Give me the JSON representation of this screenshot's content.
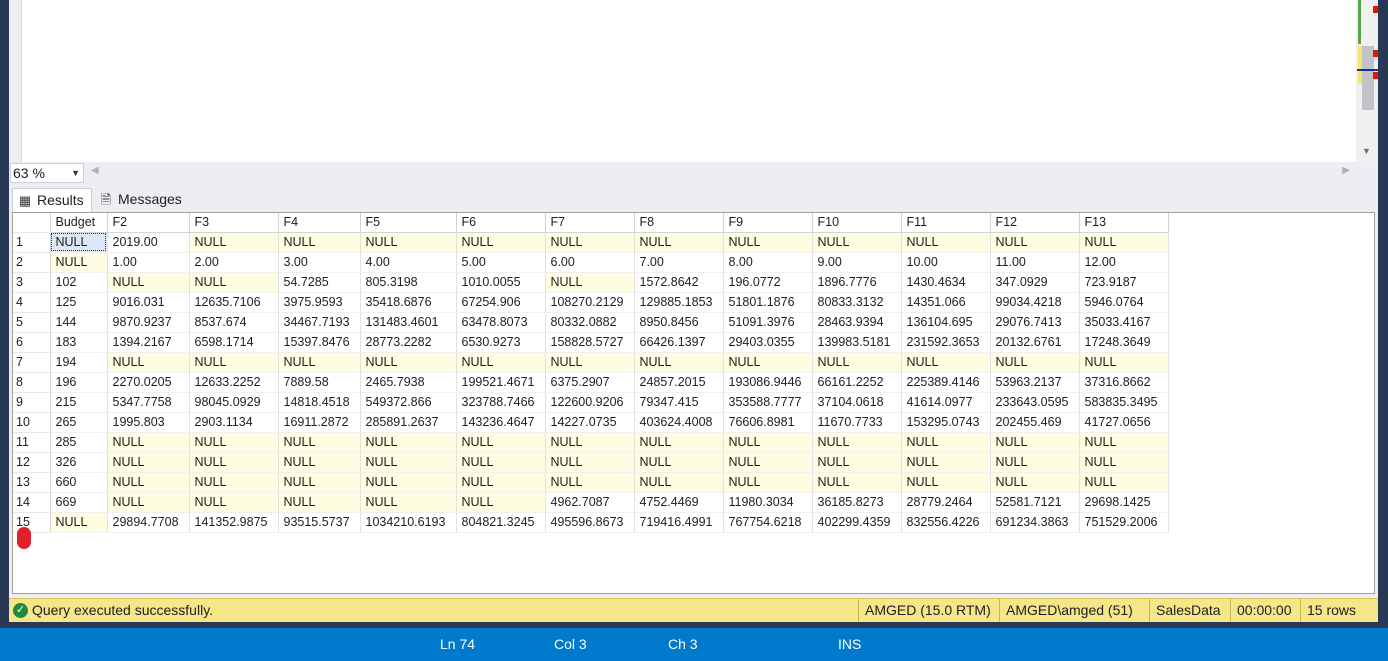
{
  "zoom": {
    "value": "63 %"
  },
  "tabs": {
    "results": "Results",
    "messages": "Messages"
  },
  "grid": {
    "columns": [
      "Budget",
      "F2",
      "F3",
      "F4",
      "F5",
      "F6",
      "F7",
      "F8",
      "F9",
      "F10",
      "F11",
      "F12",
      "F13"
    ],
    "rows": [
      [
        "1",
        "NULL",
        "2019.00",
        "NULL",
        "NULL",
        "NULL",
        "NULL",
        "NULL",
        "NULL",
        "NULL",
        "NULL",
        "NULL",
        "NULL",
        "NULL"
      ],
      [
        "2",
        "NULL",
        "1.00",
        "2.00",
        "3.00",
        "4.00",
        "5.00",
        "6.00",
        "7.00",
        "8.00",
        "9.00",
        "10.00",
        "11.00",
        "12.00"
      ],
      [
        "3",
        "102",
        "NULL",
        "NULL",
        "54.7285",
        "805.3198",
        "1010.0055",
        "NULL",
        "1572.8642",
        "196.0772",
        "1896.7776",
        "1430.4634",
        "347.0929",
        "723.9187"
      ],
      [
        "4",
        "125",
        "9016.031",
        "12635.7106",
        "3975.9593",
        "35418.6876",
        "67254.906",
        "108270.2129",
        "129885.1853",
        "51801.1876",
        "80833.3132",
        "14351.066",
        "99034.4218",
        "5946.0764"
      ],
      [
        "5",
        "144",
        "9870.9237",
        "8537.674",
        "34467.7193",
        "131483.4601",
        "63478.8073",
        "80332.0882",
        "8950.8456",
        "51091.3976",
        "28463.9394",
        "136104.695",
        "29076.7413",
        "35033.4167"
      ],
      [
        "6",
        "183",
        "1394.2167",
        "6598.1714",
        "15397.8476",
        "28773.2282",
        "6530.9273",
        "158828.5727",
        "66426.1397",
        "29403.0355",
        "139983.5181",
        "231592.3653",
        "20132.6761",
        "17248.3649"
      ],
      [
        "7",
        "194",
        "NULL",
        "NULL",
        "NULL",
        "NULL",
        "NULL",
        "NULL",
        "NULL",
        "NULL",
        "NULL",
        "NULL",
        "NULL",
        "NULL"
      ],
      [
        "8",
        "196",
        "2270.0205",
        "12633.2252",
        "7889.58",
        "2465.7938",
        "199521.4671",
        "6375.2907",
        "24857.2015",
        "193086.9446",
        "66161.2252",
        "225389.4146",
        "53963.2137",
        "37316.8662"
      ],
      [
        "9",
        "215",
        "5347.7758",
        "98045.0929",
        "14818.4518",
        "549372.866",
        "323788.7466",
        "122600.9206",
        "79347.415",
        "353588.7777",
        "37104.0618",
        "41614.0977",
        "233643.0595",
        "583835.3495"
      ],
      [
        "10",
        "265",
        "1995.803",
        "2903.1134",
        "16911.2872",
        "285891.2637",
        "143236.4647",
        "14227.0735",
        "403624.4008",
        "76606.8981",
        "11670.7733",
        "153295.0743",
        "202455.469",
        "41727.0656"
      ],
      [
        "11",
        "285",
        "NULL",
        "NULL",
        "NULL",
        "NULL",
        "NULL",
        "NULL",
        "NULL",
        "NULL",
        "NULL",
        "NULL",
        "NULL",
        "NULL"
      ],
      [
        "12",
        "326",
        "NULL",
        "NULL",
        "NULL",
        "NULL",
        "NULL",
        "NULL",
        "NULL",
        "NULL",
        "NULL",
        "NULL",
        "NULL",
        "NULL"
      ],
      [
        "13",
        "660",
        "NULL",
        "NULL",
        "NULL",
        "NULL",
        "NULL",
        "NULL",
        "NULL",
        "NULL",
        "NULL",
        "NULL",
        "NULL",
        "NULL"
      ],
      [
        "14",
        "669",
        "NULL",
        "NULL",
        "NULL",
        "NULL",
        "NULL",
        "4962.7087",
        "4752.4469",
        "11980.3034",
        "36185.8273",
        "28779.2464",
        "52581.7121",
        "29698.1425"
      ],
      [
        "15",
        "NULL",
        "29894.7708",
        "141352.9875",
        "93515.5737",
        "1034210.6193",
        "804821.3245",
        "495596.8673",
        "719416.4991",
        "767754.6218",
        "402299.4359",
        "832556.4226",
        "691234.3863",
        "751529.2006"
      ]
    ]
  },
  "status": {
    "message": "Query executed successfully.",
    "server": "AMGED (15.0 RTM)",
    "user": "AMGED\\amged (51)",
    "database": "SalesData",
    "elapsed": "00:00:00",
    "rows": "15 rows"
  },
  "app_status": {
    "ln": "Ln 74",
    "col": "Col 3",
    "ch": "Ch 3",
    "mode": "INS"
  },
  "colors": {
    "accent": "#007acc",
    "null_cell": "#fffde1",
    "status_bar": "#f6e68a",
    "success": "#1d8a3c"
  }
}
